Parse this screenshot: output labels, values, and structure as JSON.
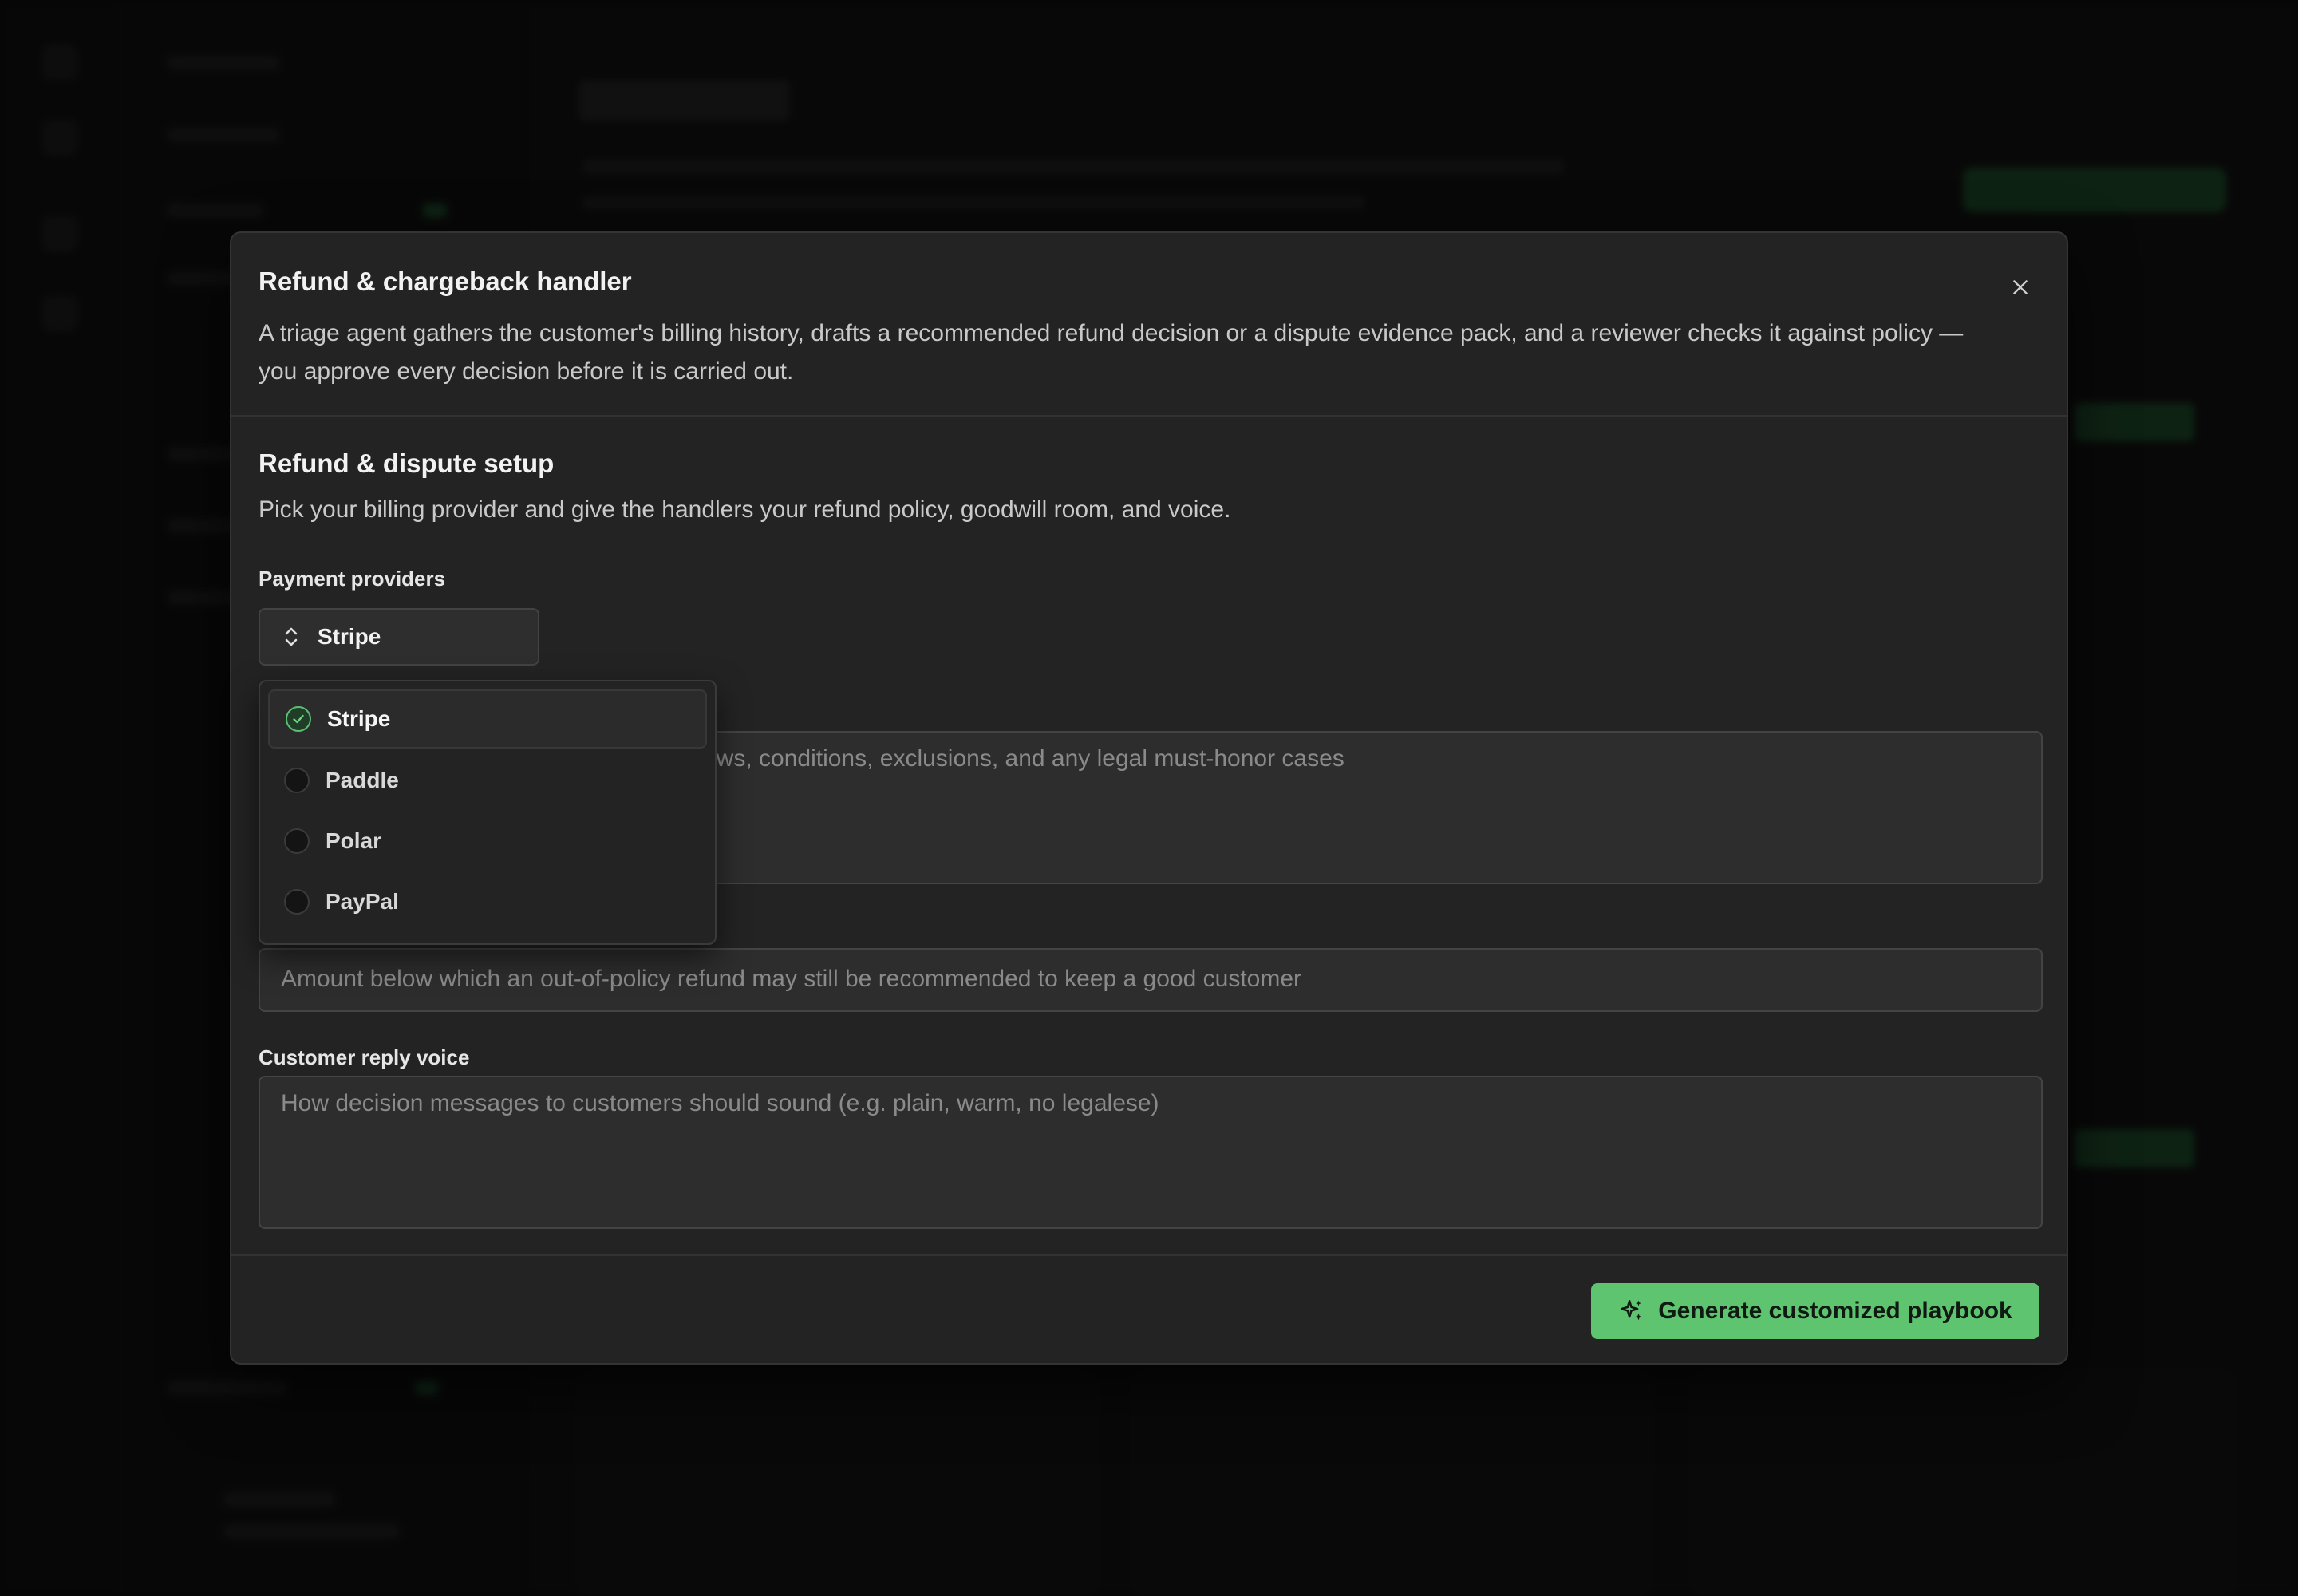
{
  "modal": {
    "title": "Refund & chargeback handler",
    "description": "A triage agent gathers the customer's billing history, drafts a recommended refund decision or a dispute evidence pack, and a reviewer checks it against policy — you approve every decision before it is carried out.",
    "close_icon": "close-icon"
  },
  "setup": {
    "title": "Refund & dispute setup",
    "description": "Pick your billing provider and give the handlers your refund policy, goodwill room, and voice."
  },
  "payment_providers": {
    "label": "Payment providers",
    "selected": "Stripe",
    "options": [
      {
        "label": "Stripe",
        "checked": true
      },
      {
        "label": "Paddle",
        "checked": false
      },
      {
        "label": "Polar",
        "checked": false
      },
      {
        "label": "PayPal",
        "checked": false
      }
    ]
  },
  "refund_policy": {
    "placeholder_visible": "ows, conditions, exclusions, and any legal must-honor cases"
  },
  "goodwill": {
    "placeholder": "Amount below which an out-of-policy refund may still be recommended to keep a good customer"
  },
  "reply_voice": {
    "label": "Customer reply voice",
    "placeholder": "How decision messages to customers should sound (e.g. plain, warm, no legalese)"
  },
  "footer": {
    "generate_label": "Generate customized playbook",
    "generate_icon": "sparkles-icon"
  },
  "colors": {
    "accent": "#5fc46f",
    "modal_bg": "#232323",
    "field_bg": "#2d2d2d"
  }
}
